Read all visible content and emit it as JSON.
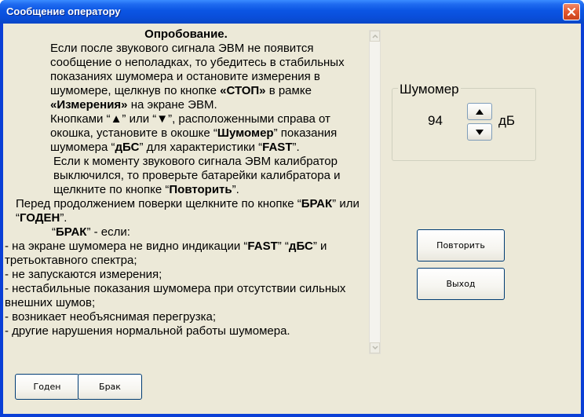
{
  "window": {
    "title": "Сообщение оператору"
  },
  "message": {
    "heading": "Опробование.",
    "paragraphs": [
      "Если после звукового сигнала ЭВМ не появится сообщение о неполадках, то убедитесь в стабильных показаниях шумомера и остановите измерения в шумомере, щелкнув по кнопке «СТОП» в рамке «Измерения» на экране ЭВМ.",
      "Кнопками “▲” или “▼”, расположенными справа от окошка, установите в окошке “Шумомер” показания шумомера “дБС” для характеристики “FAST”.",
      "Если к моменту звукового сигнала ЭВМ калибратор выключился, то проверьте батарейки калибратора и щелкните по кнопке “Повторить”.",
      "Перед продолжением поверки щелкните по кнопке “БРАК” или “ГОДЕН”.",
      "“БРАК” - если:"
    ],
    "list": [
      "- на экране шумомера не видно индикации “FAST” “дБС” и третьоктавного спектра;",
      "- не запускаются измерения;",
      "- нестабильные показания шумомера при отсутствии сильных внешних шумов;",
      "- возникает необъяснимая перегрузка;",
      "- другие нарушения нормальной работы шумомера."
    ]
  },
  "meter": {
    "label": "Шумомер",
    "value": "94",
    "unit": "дБ"
  },
  "buttons": {
    "repeat": "Повторить",
    "exit": "Выход",
    "good": "Годен",
    "reject": "Брак"
  },
  "icons": {
    "close": "close-icon",
    "spin_up": "triangle-up-icon",
    "spin_down": "triangle-down-icon",
    "scroll_up": "chevron-up-icon",
    "scroll_down": "chevron-down-icon"
  }
}
